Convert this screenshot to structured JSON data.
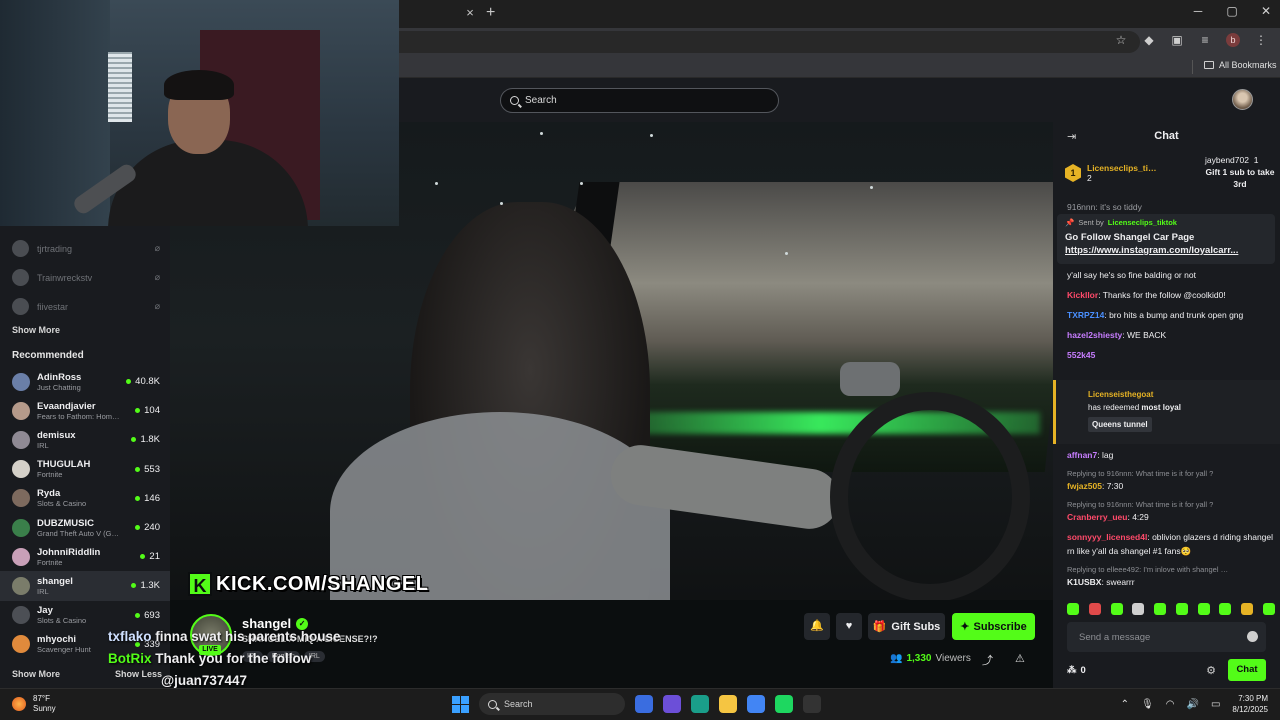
{
  "browser": {
    "tab_close": "×",
    "tab_new": "+",
    "window_controls": [
      "─",
      "▢",
      "✕"
    ],
    "toolbar_icons": [
      "star-icon",
      "extension-icon",
      "puzzle-icon",
      "media-icon"
    ],
    "profile_initial": "b",
    "all_bookmarks": "All Bookmarks"
  },
  "header": {
    "search_placeholder": "Search"
  },
  "sidebar": {
    "followed": [
      {
        "name": "tjrtrading",
        "status": "offline"
      },
      {
        "name": "Trainwreckstv",
        "status": "offline"
      },
      {
        "name": "fiivestar",
        "status": "offline"
      }
    ],
    "show_more_followed": "Show More",
    "recommended_title": "Recommended",
    "recommended": [
      {
        "name": "AdinRoss",
        "category": "Just Chatting",
        "viewers": "40.8K",
        "color": "#6a7fa8"
      },
      {
        "name": "Evaandjavier",
        "category": "Fears to Fathom: Hom…",
        "viewers": "104",
        "color": "#b59a8a"
      },
      {
        "name": "demisux",
        "category": "IRL",
        "viewers": "1.8K",
        "color": "#8f8a94"
      },
      {
        "name": "THUGULAH",
        "category": "Fortnite",
        "viewers": "553",
        "color": "#d4d0c8"
      },
      {
        "name": "Ryda",
        "category": "Slots & Casino",
        "viewers": "146",
        "color": "#7d6a5e"
      },
      {
        "name": "DUBZMUSIC",
        "category": "Grand Theft Auto V (G…",
        "viewers": "240",
        "color": "#3a7f4a"
      },
      {
        "name": "JohnniRiddlin",
        "category": "Fortnite",
        "viewers": "21",
        "color": "#c9a0b8"
      },
      {
        "name": "shangel",
        "category": "IRL",
        "viewers": "1.3K",
        "color": "#7a7c6a"
      },
      {
        "name": "Jay",
        "category": "Slots & Casino",
        "viewers": "693",
        "color": "#4c4f55"
      },
      {
        "name": "mhyochi",
        "category": "Scavenger Hunt",
        "viewers": "339",
        "color": "#e08a3c"
      }
    ],
    "show_more": "Show More",
    "show_less": "Show Less"
  },
  "video": {
    "overlay_url": "KICK.COM/SHANGEL",
    "overlay_k": "K",
    "overlay_chat": [
      {
        "user": "txflako",
        "text": "finna swat his parents house"
      },
      {
        "user": "BotRix",
        "text": "Thank you for the follow"
      },
      {
        "user": "",
        "text": "@juan737447"
      }
    ]
  },
  "stream": {
    "streamer": "shangel",
    "live_label": "LIVE",
    "title": "SHANGEL X MIQ A LICENSE?!?",
    "tags": [
      "IRL",
      "English",
      "IRL"
    ],
    "gift_subs": "Gift Subs",
    "subscribe": "Subscribe",
    "viewer_count": "1,330",
    "viewers_label": "Viewers"
  },
  "chat": {
    "title": "Chat",
    "top_gifter": {
      "rank": "1",
      "name": "Licenseclips_ti…",
      "count": "2"
    },
    "second_gifter": {
      "name": "jaybend702",
      "count": "1",
      "cta": "Gift 1 sub to take 3rd"
    },
    "cut_line": "916nnn: it's so tiddy",
    "pinned": {
      "sent_by": "Sent by",
      "sender": "Licenseclips_tiktok",
      "text": "Go Follow Shangel Car Page",
      "link": "https://www.instagram.com/loyalcarr..."
    },
    "messages": [
      {
        "user": "",
        "text": "y'all say he's so fine balding or not",
        "color": "#efeff1"
      },
      {
        "user": "Kickllor",
        "text": "Thanks for the follow @coolkid0!",
        "color": "#ff4a6a"
      },
      {
        "user": "TXRPZ14",
        "text": "bro hits a bump and trunk open gng",
        "color": "#4a90ff"
      },
      {
        "user": "hazel2shiesty",
        "text": "WE BACK",
        "color": "#c77dff"
      },
      {
        "user": "552k45",
        "text": "",
        "color": "#c77dff"
      }
    ],
    "redeem": {
      "user": "Licenseisthegoat",
      "action": "has redeemed",
      "what": "most loyal",
      "reward": "Queens tunnel"
    },
    "messages2": [
      {
        "reply": "",
        "user": "affnan7",
        "text": "lag",
        "color": "#c77dff"
      },
      {
        "reply": "Replying to 916nnn: What time is it for yall ?",
        "user": "fwjaz505",
        "text": "7:30",
        "color": "#e6b325"
      },
      {
        "reply": "Replying to 916nnn: What time is it for yall ?",
        "user": "Cranberry_ueu",
        "text": "4:29",
        "color": "#ff4a6a"
      },
      {
        "reply": "",
        "user": "sonnyyy_licensed4l",
        "text": "oblivion glazers d riding shangel rn like y'all da shangel #1 fans🥺",
        "color": "#ff4a6a"
      },
      {
        "reply": "Replying to elleee492: I'm inlove with shangel …",
        "user": "K1USBX",
        "text": "swearrr",
        "color": "#efeff1"
      }
    ],
    "input_placeholder": "Send a message",
    "points": "0",
    "chat_button": "Chat"
  },
  "taskbar": {
    "temp": "87°F",
    "condition": "Sunny",
    "search": "Search",
    "time": "7:30 PM",
    "date": "8/12/2025",
    "apps": [
      "#3a6de0",
      "#6c4fd8",
      "#1a9e8a",
      "#f5c542",
      "#4285f4",
      "#1ed760",
      "#333333"
    ]
  },
  "colors": {
    "accent": "#53fc18",
    "background": "#0b0e0f",
    "panel": "#191b1f"
  }
}
